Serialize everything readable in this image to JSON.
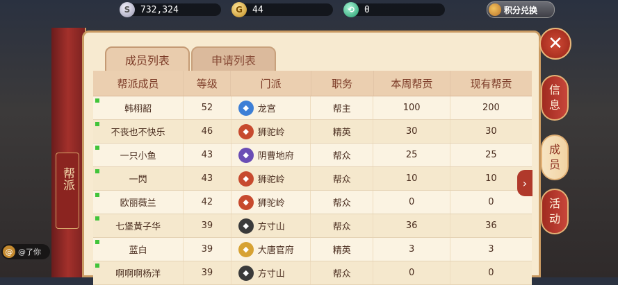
{
  "resources": {
    "silver": {
      "value": "732,324",
      "icon": "silver-coin-icon",
      "color": "#c9c8d9"
    },
    "gold": {
      "value": "44",
      "icon": "gold-coin-icon",
      "color": "#e2b546"
    },
    "jade": {
      "value": "0",
      "icon": "jade-currency-icon",
      "color": "#37c48f"
    }
  },
  "exchange_label": "积分兑换",
  "side_title": "帮派",
  "tabs": [
    "成员列表",
    "申请列表"
  ],
  "columns": [
    "帮派成员",
    "等级",
    "门派",
    "职务",
    "本周帮贡",
    "现有帮贡"
  ],
  "members": [
    {
      "name": "韩栩韶",
      "level": "52",
      "school": "龙宫",
      "school_icon": "dragon-palace-icon",
      "school_color": "#3d7fd6",
      "role": "帮主",
      "weekly": "100",
      "total": "200"
    },
    {
      "name": "不丧也不快乐",
      "level": "46",
      "school": "狮驼岭",
      "school_icon": "lion-camel-icon",
      "school_color": "#c74a2e",
      "role": "精英",
      "weekly": "30",
      "total": "30"
    },
    {
      "name": "一只小鱼",
      "level": "43",
      "school": "阴曹地府",
      "school_icon": "underworld-icon",
      "school_color": "#6a4db5",
      "role": "帮众",
      "weekly": "25",
      "total": "25"
    },
    {
      "name": "一閃",
      "level": "43",
      "school": "狮驼岭",
      "school_icon": "lion-camel-icon",
      "school_color": "#c74a2e",
      "role": "帮众",
      "weekly": "10",
      "total": "10"
    },
    {
      "name": "欧丽薇兰",
      "level": "42",
      "school": "狮驼岭",
      "school_icon": "lion-camel-icon",
      "school_color": "#c74a2e",
      "role": "帮众",
      "weekly": "0",
      "total": "0"
    },
    {
      "name": "七堡黄子华",
      "level": "39",
      "school": "方寸山",
      "school_icon": "fangcun-icon",
      "school_color": "#3a3a3a",
      "role": "帮众",
      "weekly": "36",
      "total": "36"
    },
    {
      "name": "蓝白",
      "level": "39",
      "school": "大唐官府",
      "school_icon": "tang-official-icon",
      "school_color": "#d7a233",
      "role": "精英",
      "weekly": "3",
      "total": "3"
    },
    {
      "name": "啊啊啊杨洋",
      "level": "39",
      "school": "方寸山",
      "school_icon": "fangcun-icon",
      "school_color": "#3a3a3a",
      "role": "帮众",
      "weekly": "0",
      "total": "0"
    }
  ],
  "right_tabs": [
    {
      "label": [
        "信",
        "息"
      ],
      "active": false
    },
    {
      "label": [
        "成",
        "员"
      ],
      "active": true
    },
    {
      "label": [
        "活",
        "动"
      ],
      "active": false
    }
  ],
  "chat_text": "@了你"
}
